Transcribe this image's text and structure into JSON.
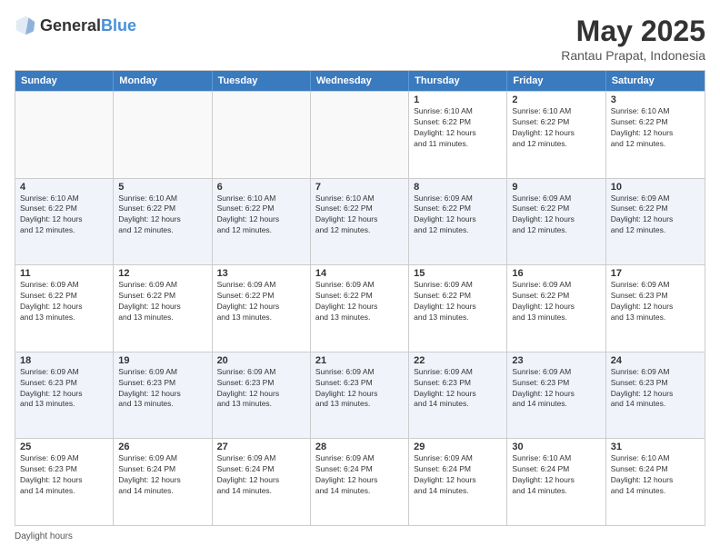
{
  "header": {
    "logo_general": "General",
    "logo_blue": "Blue",
    "title": "May 2025",
    "subtitle": "Rantau Prapat, Indonesia"
  },
  "calendar": {
    "days_of_week": [
      "Sunday",
      "Monday",
      "Tuesday",
      "Wednesday",
      "Thursday",
      "Friday",
      "Saturday"
    ],
    "rows": [
      [
        {
          "day": "",
          "info": ""
        },
        {
          "day": "",
          "info": ""
        },
        {
          "day": "",
          "info": ""
        },
        {
          "day": "",
          "info": ""
        },
        {
          "day": "1",
          "info": "Sunrise: 6:10 AM\nSunset: 6:22 PM\nDaylight: 12 hours\nand 11 minutes."
        },
        {
          "day": "2",
          "info": "Sunrise: 6:10 AM\nSunset: 6:22 PM\nDaylight: 12 hours\nand 12 minutes."
        },
        {
          "day": "3",
          "info": "Sunrise: 6:10 AM\nSunset: 6:22 PM\nDaylight: 12 hours\nand 12 minutes."
        }
      ],
      [
        {
          "day": "4",
          "info": "Sunrise: 6:10 AM\nSunset: 6:22 PM\nDaylight: 12 hours\nand 12 minutes."
        },
        {
          "day": "5",
          "info": "Sunrise: 6:10 AM\nSunset: 6:22 PM\nDaylight: 12 hours\nand 12 minutes."
        },
        {
          "day": "6",
          "info": "Sunrise: 6:10 AM\nSunset: 6:22 PM\nDaylight: 12 hours\nand 12 minutes."
        },
        {
          "day": "7",
          "info": "Sunrise: 6:10 AM\nSunset: 6:22 PM\nDaylight: 12 hours\nand 12 minutes."
        },
        {
          "day": "8",
          "info": "Sunrise: 6:09 AM\nSunset: 6:22 PM\nDaylight: 12 hours\nand 12 minutes."
        },
        {
          "day": "9",
          "info": "Sunrise: 6:09 AM\nSunset: 6:22 PM\nDaylight: 12 hours\nand 12 minutes."
        },
        {
          "day": "10",
          "info": "Sunrise: 6:09 AM\nSunset: 6:22 PM\nDaylight: 12 hours\nand 12 minutes."
        }
      ],
      [
        {
          "day": "11",
          "info": "Sunrise: 6:09 AM\nSunset: 6:22 PM\nDaylight: 12 hours\nand 13 minutes."
        },
        {
          "day": "12",
          "info": "Sunrise: 6:09 AM\nSunset: 6:22 PM\nDaylight: 12 hours\nand 13 minutes."
        },
        {
          "day": "13",
          "info": "Sunrise: 6:09 AM\nSunset: 6:22 PM\nDaylight: 12 hours\nand 13 minutes."
        },
        {
          "day": "14",
          "info": "Sunrise: 6:09 AM\nSunset: 6:22 PM\nDaylight: 12 hours\nand 13 minutes."
        },
        {
          "day": "15",
          "info": "Sunrise: 6:09 AM\nSunset: 6:22 PM\nDaylight: 12 hours\nand 13 minutes."
        },
        {
          "day": "16",
          "info": "Sunrise: 6:09 AM\nSunset: 6:22 PM\nDaylight: 12 hours\nand 13 minutes."
        },
        {
          "day": "17",
          "info": "Sunrise: 6:09 AM\nSunset: 6:23 PM\nDaylight: 12 hours\nand 13 minutes."
        }
      ],
      [
        {
          "day": "18",
          "info": "Sunrise: 6:09 AM\nSunset: 6:23 PM\nDaylight: 12 hours\nand 13 minutes."
        },
        {
          "day": "19",
          "info": "Sunrise: 6:09 AM\nSunset: 6:23 PM\nDaylight: 12 hours\nand 13 minutes."
        },
        {
          "day": "20",
          "info": "Sunrise: 6:09 AM\nSunset: 6:23 PM\nDaylight: 12 hours\nand 13 minutes."
        },
        {
          "day": "21",
          "info": "Sunrise: 6:09 AM\nSunset: 6:23 PM\nDaylight: 12 hours\nand 13 minutes."
        },
        {
          "day": "22",
          "info": "Sunrise: 6:09 AM\nSunset: 6:23 PM\nDaylight: 12 hours\nand 14 minutes."
        },
        {
          "day": "23",
          "info": "Sunrise: 6:09 AM\nSunset: 6:23 PM\nDaylight: 12 hours\nand 14 minutes."
        },
        {
          "day": "24",
          "info": "Sunrise: 6:09 AM\nSunset: 6:23 PM\nDaylight: 12 hours\nand 14 minutes."
        }
      ],
      [
        {
          "day": "25",
          "info": "Sunrise: 6:09 AM\nSunset: 6:23 PM\nDaylight: 12 hours\nand 14 minutes."
        },
        {
          "day": "26",
          "info": "Sunrise: 6:09 AM\nSunset: 6:24 PM\nDaylight: 12 hours\nand 14 minutes."
        },
        {
          "day": "27",
          "info": "Sunrise: 6:09 AM\nSunset: 6:24 PM\nDaylight: 12 hours\nand 14 minutes."
        },
        {
          "day": "28",
          "info": "Sunrise: 6:09 AM\nSunset: 6:24 PM\nDaylight: 12 hours\nand 14 minutes."
        },
        {
          "day": "29",
          "info": "Sunrise: 6:09 AM\nSunset: 6:24 PM\nDaylight: 12 hours\nand 14 minutes."
        },
        {
          "day": "30",
          "info": "Sunrise: 6:10 AM\nSunset: 6:24 PM\nDaylight: 12 hours\nand 14 minutes."
        },
        {
          "day": "31",
          "info": "Sunrise: 6:10 AM\nSunset: 6:24 PM\nDaylight: 12 hours\nand 14 minutes."
        }
      ]
    ]
  },
  "footer": {
    "daylight_label": "Daylight hours"
  },
  "colors": {
    "header_bg": "#3a7abf",
    "alt_row_bg": "#edf2fb",
    "empty_bg": "#f5f5f5"
  }
}
